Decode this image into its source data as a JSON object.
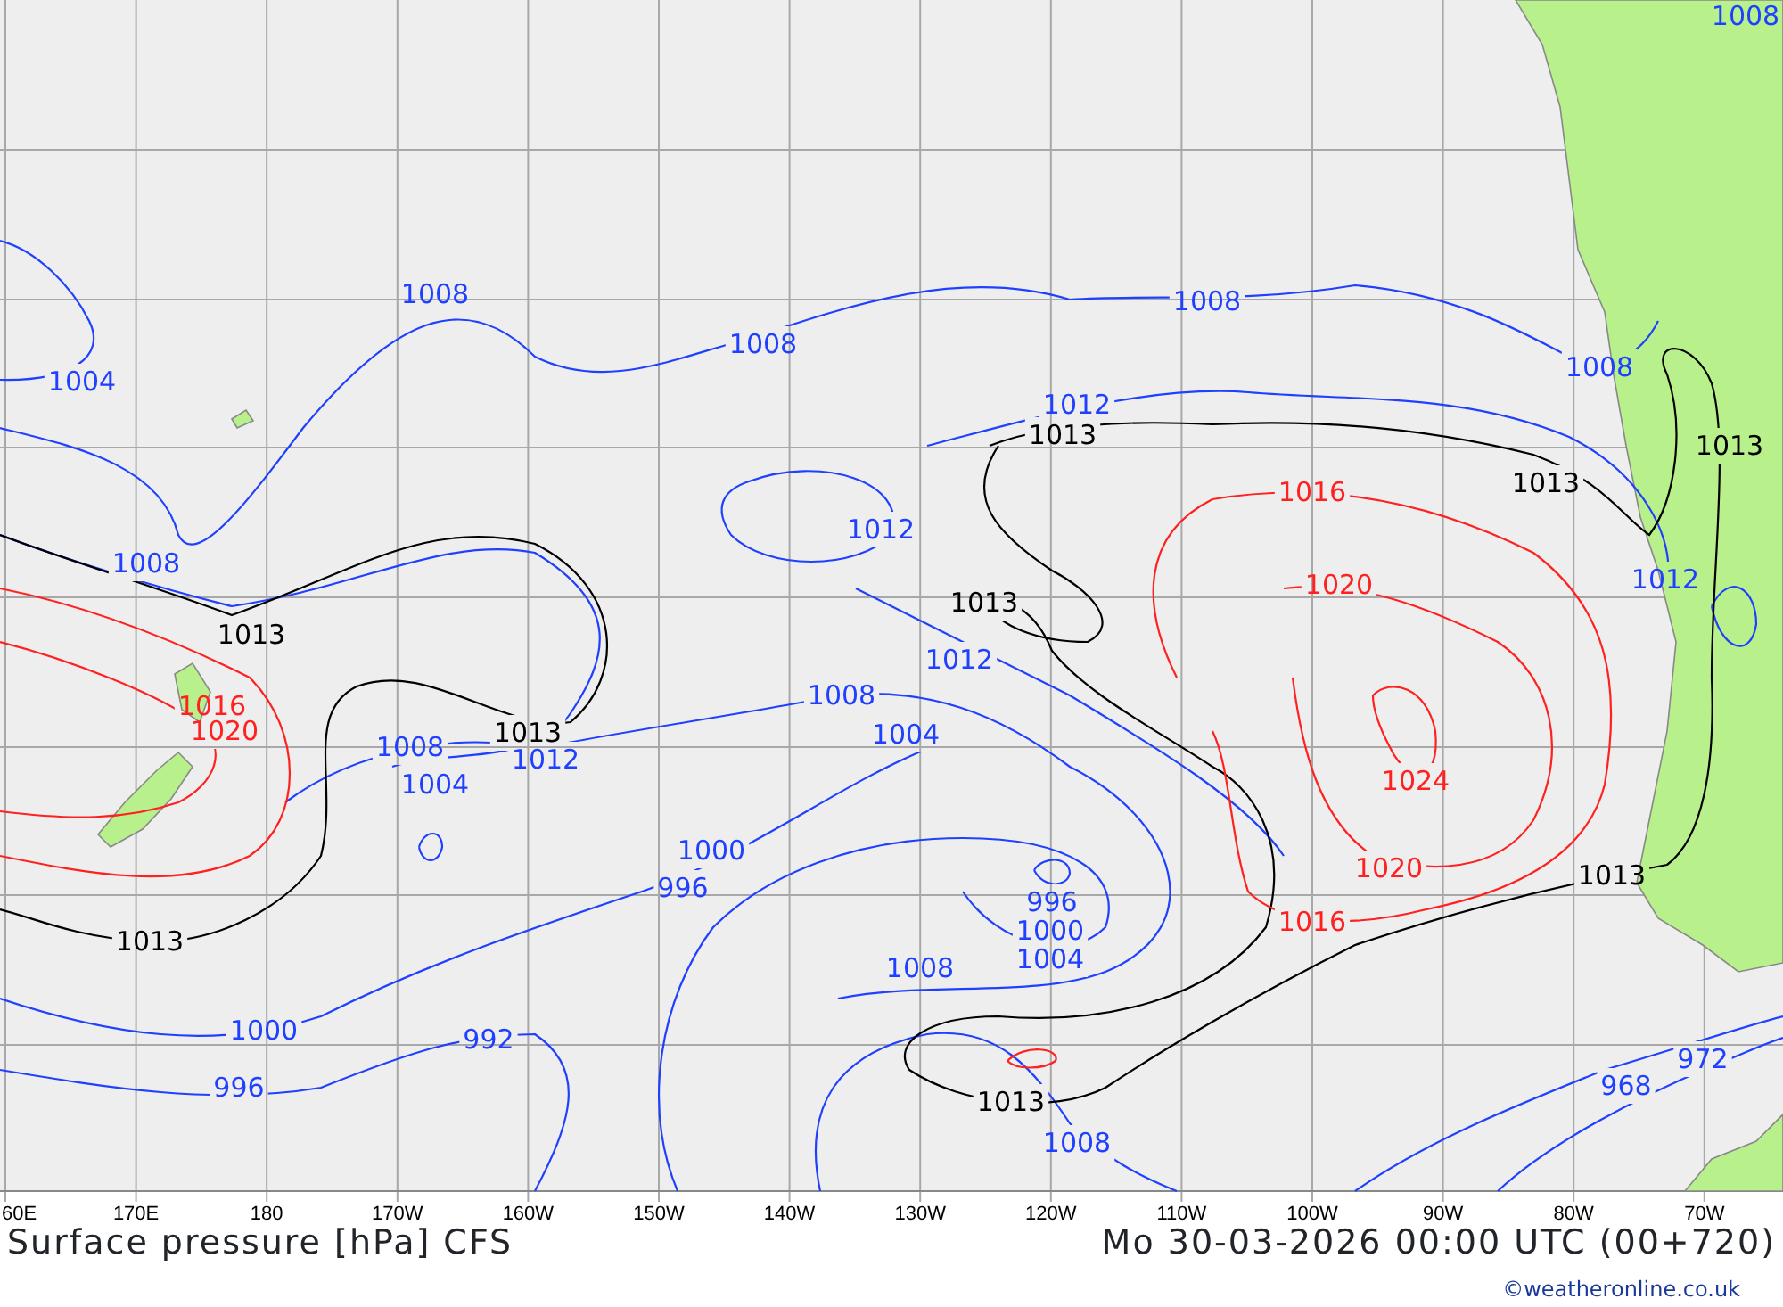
{
  "map": {
    "isobar_labels": [
      {
        "text": "1008",
        "color": "#2040ff"
      },
      {
        "text": "1004",
        "color": "#2040ff"
      },
      {
        "text": "1008",
        "color": "#2040ff"
      },
      {
        "text": "1008",
        "color": "#2040ff"
      },
      {
        "text": "1008",
        "color": "#2040ff"
      },
      {
        "text": "1008",
        "color": "#2040ff"
      },
      {
        "text": "1012",
        "color": "#2040ff"
      },
      {
        "text": "1012",
        "color": "#2040ff"
      },
      {
        "text": "1008",
        "color": "#2040ff"
      },
      {
        "text": "1012",
        "color": "#2040ff"
      },
      {
        "text": "1012",
        "color": "#2040ff"
      },
      {
        "text": "1008",
        "color": "#2040ff"
      },
      {
        "text": "1004",
        "color": "#2040ff"
      },
      {
        "text": "1008",
        "color": "#2040ff"
      },
      {
        "text": "1012",
        "color": "#2040ff"
      },
      {
        "text": "1004",
        "color": "#2040ff"
      },
      {
        "text": "1000",
        "color": "#2040ff"
      },
      {
        "text": "996",
        "color": "#2040ff"
      },
      {
        "text": "996",
        "color": "#2040ff"
      },
      {
        "text": "1000",
        "color": "#2040ff"
      },
      {
        "text": "1004",
        "color": "#2040ff"
      },
      {
        "text": "1008",
        "color": "#2040ff"
      },
      {
        "text": "1000",
        "color": "#2040ff"
      },
      {
        "text": "996",
        "color": "#2040ff"
      },
      {
        "text": "992",
        "color": "#2040ff"
      },
      {
        "text": "1008",
        "color": "#2040ff"
      },
      {
        "text": "968",
        "color": "#2040ff"
      },
      {
        "text": "972",
        "color": "#2040ff"
      },
      {
        "text": "1013",
        "color": "#000000"
      },
      {
        "text": "1013",
        "color": "#000000"
      },
      {
        "text": "1013",
        "color": "#000000"
      },
      {
        "text": "1013",
        "color": "#000000"
      },
      {
        "text": "1013",
        "color": "#000000"
      },
      {
        "text": "1013",
        "color": "#000000"
      },
      {
        "text": "1013",
        "color": "#000000"
      },
      {
        "text": "1013",
        "color": "#000000"
      },
      {
        "text": "1013",
        "color": "#000000"
      },
      {
        "text": "1016",
        "color": "#ff2020"
      },
      {
        "text": "1020",
        "color": "#ff2020"
      },
      {
        "text": "1016",
        "color": "#ff2020"
      },
      {
        "text": "1020",
        "color": "#ff2020"
      },
      {
        "text": "1024",
        "color": "#ff2020"
      },
      {
        "text": "1020",
        "color": "#ff2020"
      },
      {
        "text": "1016",
        "color": "#ff2020"
      }
    ],
    "longitude_labels": [
      "60E",
      "170E",
      "180",
      "170W",
      "160W",
      "150W",
      "140W",
      "130W",
      "120W",
      "110W",
      "100W",
      "90W",
      "80W",
      "70W"
    ]
  },
  "title": "Surface pressure [hPa] CFS",
  "valid_time": "Mo 30-03-2026 00:00 UTC (00+720)",
  "credit": "©weatheronline.co.uk"
}
